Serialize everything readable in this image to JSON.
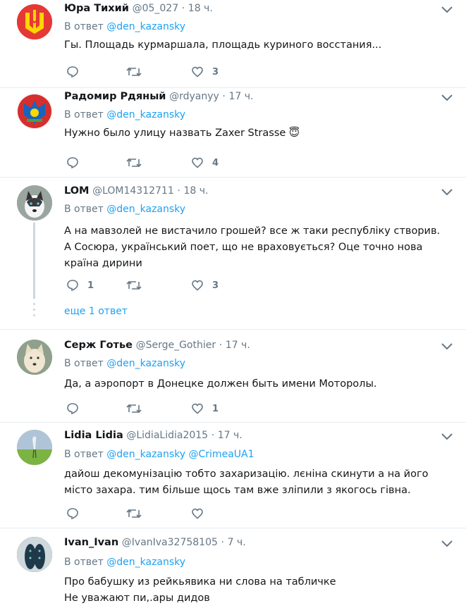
{
  "tweets": [
    {
      "name": "Юра Тихий",
      "handle": "@05_027",
      "dot": "·",
      "time": "18 ч.",
      "reply_prefix": "В ответ",
      "mentions": [
        "@den_kazansky"
      ],
      "text": "Гы. Площадь курмаршала, площадь куриного восстания...",
      "replies": "",
      "retweets": "",
      "likes": "3",
      "avatar_icon": "ukraine-coat-of-arms-avatar"
    },
    {
      "name": "Радомир Рдяный",
      "handle": "@rdyanyy",
      "dot": "·",
      "time": "17 ч.",
      "reply_prefix": "В ответ",
      "mentions": [
        "@den_kazansky"
      ],
      "text": "Нужно было улицу назвать Zaxer Strasse",
      "emoji": "😇",
      "replies": "",
      "retweets": "",
      "likes": "4",
      "avatar_icon": "heraldic-emblem-avatar"
    },
    {
      "name": "LOM",
      "handle": "@LOM14312711",
      "dot": "·",
      "time": "18 ч.",
      "reply_prefix": "В ответ",
      "mentions": [
        "@den_kazansky"
      ],
      "text": "А на мавзолей не вистачило грошей? все ж таки республіку створив. А Сосюра, український поет, що не враховується? Оце точно нова країна дирини",
      "replies": "1",
      "retweets": "",
      "likes": "3",
      "more_replies": "еще 1 ответ",
      "avatar_icon": "husky-dog-avatar"
    },
    {
      "name": "Серж Готье",
      "handle": "@Serge_Gothier",
      "dot": "·",
      "time": "17 ч.",
      "reply_prefix": "В ответ",
      "mentions": [
        "@den_kazansky"
      ],
      "text": "Да, а аэропорт в Донецке должен быть имени Моторолы.",
      "replies": "",
      "retweets": "",
      "likes": "1",
      "avatar_icon": "white-dog-avatar"
    },
    {
      "name": "Lidia Lidia",
      "handle": "@LidiaLidia2015",
      "dot": "·",
      "time": "17 ч.",
      "reply_prefix": "В ответ",
      "mentions": [
        "@den_kazansky",
        "@CrimeaUA1"
      ],
      "text": "дайош декомунізацію тобто захаризацію. лєніна скинути а на його місто захара. тим більше щось там вже зліпили з якогось гівна.",
      "replies": "",
      "retweets": "",
      "likes": "",
      "avatar_icon": "heron-landscape-avatar"
    },
    {
      "name": "Ivan_Ivan",
      "handle": "@IvanIva32758105",
      "dot": "·",
      "time": "7 ч.",
      "reply_prefix": "В ответ",
      "mentions": [
        "@den_kazansky"
      ],
      "text": "Про бабушку из рейкьявика ни слова на табличке\nНе уважают пи,.ары дидов",
      "replies": "",
      "retweets": "",
      "likes": "",
      "avatar_icon": "feet-photo-avatar"
    }
  ],
  "colors": {
    "link": "#1da1f2",
    "secondary": "#657786",
    "border": "#e6ecf0",
    "text": "#14171a"
  },
  "icons": {
    "reply": "reply-icon",
    "retweet": "retweet-icon",
    "like": "heart-icon",
    "menu": "chevron-down-icon"
  }
}
